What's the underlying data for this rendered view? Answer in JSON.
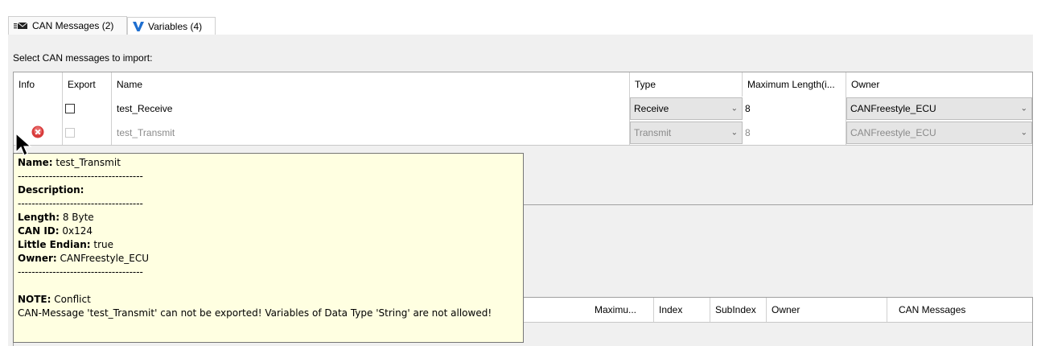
{
  "tabs": [
    {
      "label": "CAN Messages (2)",
      "icon": "can-messages-icon",
      "active": true
    },
    {
      "label": "Variables (4)",
      "icon": "variables-icon",
      "active": false
    }
  ],
  "prompt": "Select CAN messages to import:",
  "messages_table": {
    "columns": [
      "Info",
      "Export",
      "Name",
      "Type",
      "Maximum Length(i...",
      "Owner"
    ],
    "rows": [
      {
        "info": "",
        "export_checked": false,
        "name": "test_Receive",
        "type": "Receive",
        "max_length": "8",
        "owner": "CANFreestyle_ECU",
        "enabled": true
      },
      {
        "info": "error-icon",
        "export_checked": false,
        "name": "test_Transmit",
        "type": "Transmit",
        "max_length": "8",
        "owner": "CANFreestyle_ECU",
        "enabled": false
      }
    ]
  },
  "variables_table": {
    "columns": [
      "Maximu...",
      "Index",
      "SubIndex",
      "Owner",
      "CAN Messages"
    ]
  },
  "tooltip": {
    "name_label": "Name:",
    "name_value": " test_Transmit",
    "separator": "------------------------------------",
    "description_label": "Description:",
    "length_label": "Length:",
    "length_value": " 8 Byte",
    "canid_label": "CAN ID:",
    "canid_value": " 0x124",
    "endian_label": "Little Endian:",
    "endian_value": " true",
    "owner_label": "Owner:",
    "owner_value": " CANFreestyle_ECU",
    "note_label": "NOTE:",
    "note_value": " Conflict",
    "message": "CAN-Message 'test_Transmit' can not be exported! Variables of Data Type 'String' are not allowed!"
  },
  "colors": {
    "accent_v": "#1f6fd0",
    "error": "#d83b3b",
    "tooltip_bg": "#ffffe1"
  }
}
